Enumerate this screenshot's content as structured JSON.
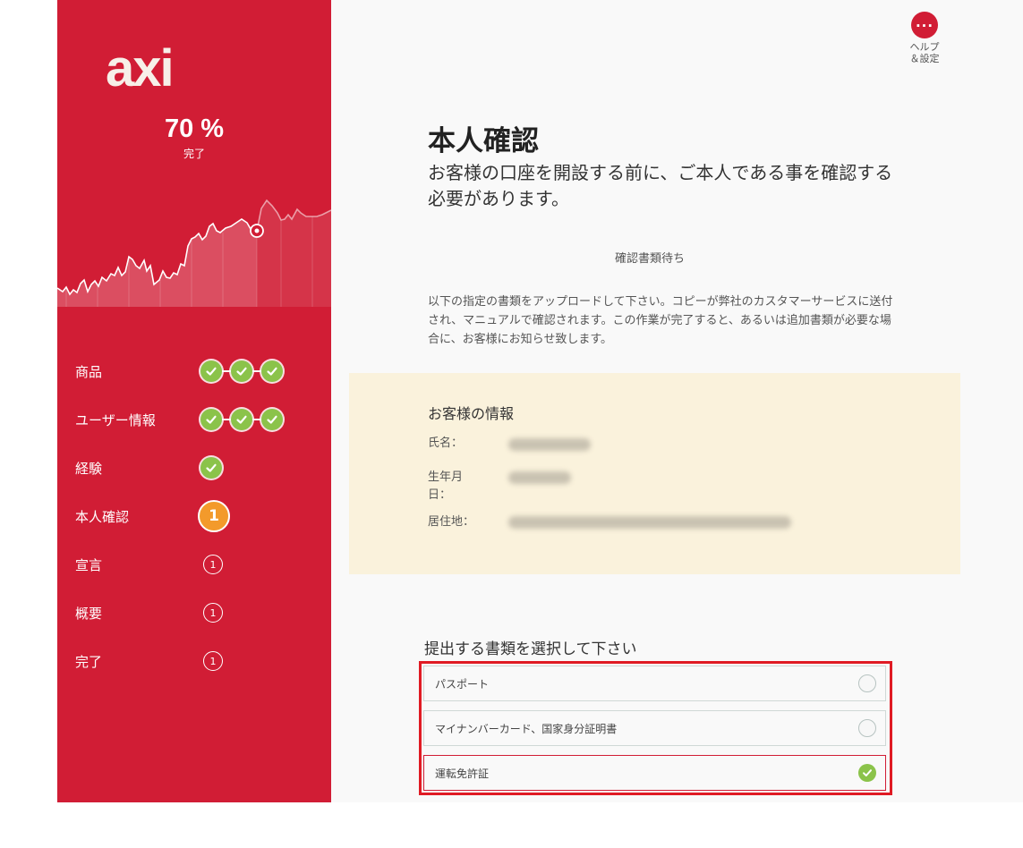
{
  "sidebar": {
    "brand": "axi",
    "progress_value": "70 %",
    "progress_label": "完了",
    "progress_fraction": 0.7,
    "steps": [
      {
        "label": "商品",
        "state": "complete",
        "checks": 3
      },
      {
        "label": "ユーザー情報",
        "state": "complete",
        "checks": 3
      },
      {
        "label": "経験",
        "state": "complete",
        "checks": 1
      },
      {
        "label": "本人確認",
        "state": "active",
        "badge": "1"
      },
      {
        "label": "宣言",
        "state": "pending",
        "badge": "1"
      },
      {
        "label": "概要",
        "state": "pending",
        "badge": "1"
      },
      {
        "label": "完了",
        "state": "pending",
        "badge": "1"
      }
    ]
  },
  "header": {
    "help_icon": "ellipsis-icon",
    "help_label": "ヘルプ\n＆設定"
  },
  "main": {
    "title": "本人確認",
    "subtitle": "お客様の口座を開設する前に、ご本人である事を確認する必要があります。",
    "status": "確認書類待ち",
    "instructions": "以下の指定の書類をアップロードして下さい。コピーが弊社のカスタマーサービスに送付され、マニュアルで確認されます。この作業が完了すると、あるいは追加書類が必要な場合に、お客様にお知らせ致します。"
  },
  "customer_info": {
    "title": "お客様の情報",
    "name_label": "氏名：",
    "dob_label": "生年月日：",
    "address_label": "居住地："
  },
  "documents": {
    "title": "提出する書類を選択して下さい",
    "options": [
      {
        "label": "パスポート",
        "selected": false
      },
      {
        "label": "マイナンバーカード、国家身分証明書",
        "selected": false
      },
      {
        "label": "運転免許証",
        "selected": true
      }
    ]
  },
  "colors": {
    "brand_red": "#d11d35",
    "check_green": "#8bc34a",
    "active_orange": "#f39a2b",
    "info_bg": "#faf2dc",
    "highlight_border": "#e01b24"
  }
}
